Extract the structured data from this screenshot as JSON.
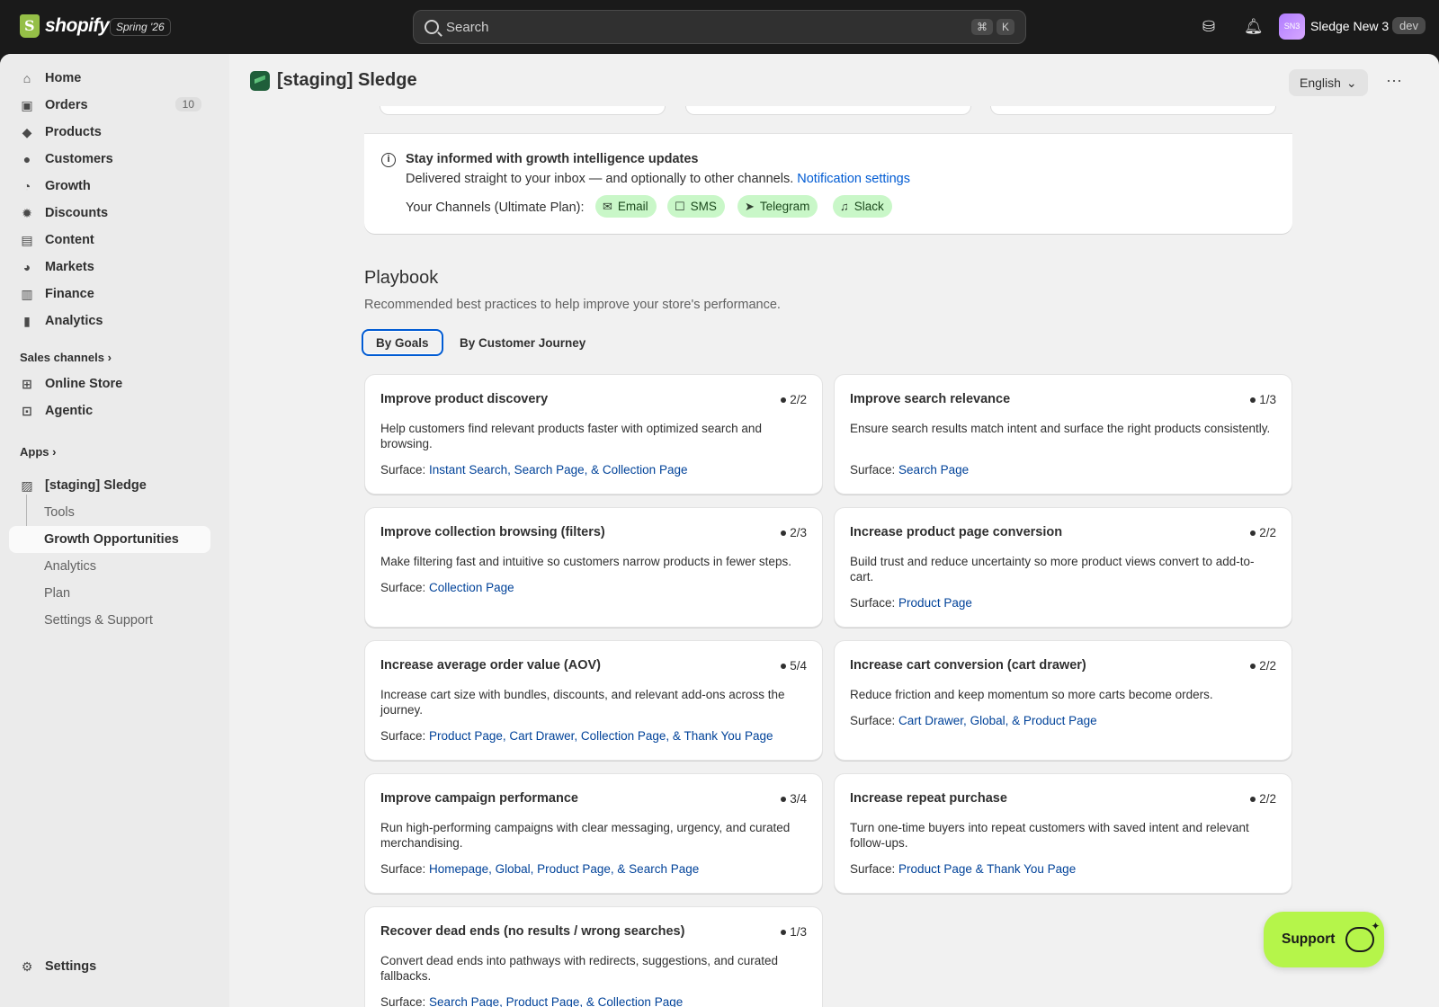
{
  "topbar": {
    "logo_text": "shopify",
    "release_badge": "Spring '26",
    "search_placeholder": "Search",
    "shortcut_cmd": "⌘",
    "shortcut_key": "K",
    "store_avatar": "SN3",
    "store_name": "Sledge New 3",
    "env_badge": "dev"
  },
  "sidebar": {
    "items": [
      {
        "label": "Home",
        "icon": "home-icon"
      },
      {
        "label": "Orders",
        "icon": "orders-icon",
        "badge": "10"
      },
      {
        "label": "Products",
        "icon": "tag-icon"
      },
      {
        "label": "Customers",
        "icon": "person-icon"
      },
      {
        "label": "Growth",
        "icon": "growth-icon"
      },
      {
        "label": "Discounts",
        "icon": "discount-icon"
      },
      {
        "label": "Content",
        "icon": "content-icon"
      },
      {
        "label": "Markets",
        "icon": "globe-icon"
      },
      {
        "label": "Finance",
        "icon": "bank-icon"
      },
      {
        "label": "Analytics",
        "icon": "bar-chart-icon"
      }
    ],
    "sales_channels_label": "Sales channels",
    "sales_channels": [
      {
        "label": "Online Store",
        "icon": "store-icon"
      },
      {
        "label": "Agentic",
        "icon": "agent-icon"
      }
    ],
    "apps_label": "Apps",
    "app_name": "[staging] Sledge",
    "app_subitems": [
      "Tools",
      "Growth Opportunities",
      "Analytics",
      "Plan",
      "Settings & Support"
    ],
    "settings_label": "Settings"
  },
  "header": {
    "title": "[staging] Sledge",
    "language": "English"
  },
  "info": {
    "title": "Stay informed with growth intelligence updates",
    "subtitle": "Delivered straight to your inbox — and optionally to other channels.",
    "link": "Notification settings",
    "channels_label": "Your Channels (Ultimate Plan):",
    "channels": [
      {
        "label": "Email",
        "icon": "mail-icon"
      },
      {
        "label": "SMS",
        "icon": "chat-icon"
      },
      {
        "label": "Telegram",
        "icon": "send-icon"
      },
      {
        "label": "Slack",
        "icon": "bell-icon"
      }
    ]
  },
  "playbook": {
    "title": "Playbook",
    "subtitle": "Recommended best practices to help improve your store's performance.",
    "tabs": [
      "By Goals",
      "By Customer Journey"
    ],
    "surface_label": "Surface:",
    "goals": [
      {
        "title": "Improve product discovery",
        "count": "2/2",
        "desc": "Help customers find relevant products faster with optimized search and browsing.",
        "surfaces": "Instant Search, Search Page, & Collection Page"
      },
      {
        "title": "Improve search relevance",
        "count": "1/3",
        "desc": "Ensure search results match intent and surface the right products consistently.",
        "surfaces": "Search Page"
      },
      {
        "title": "Improve collection browsing (filters)",
        "count": "2/3",
        "desc": "Make filtering fast and intuitive so customers narrow products in fewer steps.",
        "surfaces": "Collection Page"
      },
      {
        "title": "Increase product page conversion",
        "count": "2/2",
        "desc": "Build trust and reduce uncertainty so more product views convert to add-to-cart.",
        "surfaces": "Product Page"
      },
      {
        "title": "Increase average order value (AOV)",
        "count": "5/4",
        "desc": "Increase cart size with bundles, discounts, and relevant add-ons across the journey.",
        "surfaces": "Product Page, Cart Drawer, Collection Page, & Thank You Page"
      },
      {
        "title": "Increase cart conversion (cart drawer)",
        "count": "2/2",
        "desc": "Reduce friction and keep momentum so more carts become orders.",
        "surfaces": "Cart Drawer, Global, & Product Page"
      },
      {
        "title": "Improve campaign performance",
        "count": "3/4",
        "desc": "Run high-performing campaigns with clear messaging, urgency, and curated merchandising.",
        "surfaces": "Homepage, Global, Product Page, & Search Page"
      },
      {
        "title": "Increase repeat purchase",
        "count": "2/2",
        "desc": "Turn one-time buyers into repeat customers with saved intent and relevant follow-ups.",
        "surfaces": "Product Page & Thank You Page"
      },
      {
        "title": "Recover dead ends (no results / wrong searches)",
        "count": "1/3",
        "desc": "Convert dead ends into pathways with redirects, suggestions, and curated fallbacks.",
        "surfaces": "Search Page, Product Page, & Collection Page"
      }
    ]
  },
  "support": {
    "label": "Support"
  }
}
